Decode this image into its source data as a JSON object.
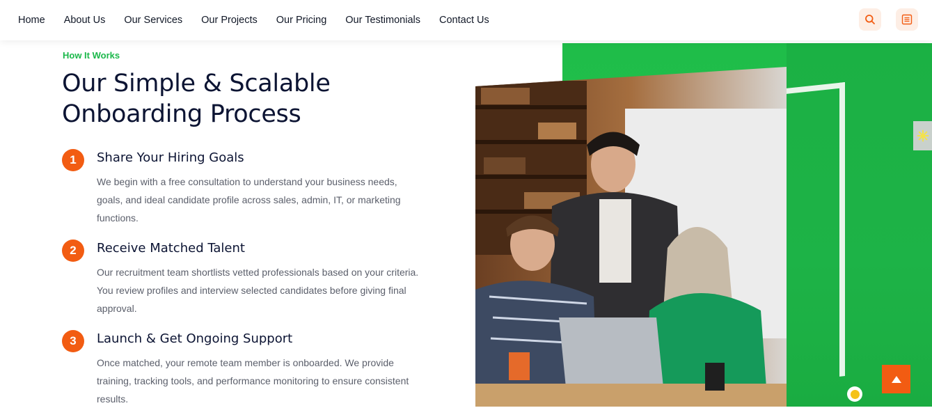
{
  "nav": {
    "items": [
      "Home",
      "About Us",
      "Our Services",
      "Our Projects",
      "Our Pricing",
      "Our Testimonials",
      "Contact Us"
    ]
  },
  "header_icons": {
    "search": "search-icon",
    "menu": "menu-list-icon"
  },
  "section": {
    "eyebrow": "How It Works",
    "title": "Our Simple & Scalable Onboarding Process",
    "steps": [
      {
        "number": "1",
        "title": "Share Your Hiring Goals",
        "desc": "We begin with a free consultation to understand your business needs, goals, and ideal candidate profile across sales, admin, IT, or marketing functions."
      },
      {
        "number": "2",
        "title": "Receive Matched Talent",
        "desc": "Our recruitment team shortlists vetted professionals based on your criteria. You review profiles and interview selected candidates before giving final approval."
      },
      {
        "number": "3",
        "title": "Launch & Get Ongoing Support",
        "desc": "Once matched, your remote team member is onboarded. We provide training, tracking tools, and performance monitoring to ensure consistent results."
      }
    ]
  },
  "colors": {
    "accent_orange": "#f25c12",
    "accent_green": "#1bb84a",
    "heading": "#0c1433",
    "body_text": "#5b5f6b"
  },
  "icons": {
    "side_tab": "settings-sun-icon",
    "back_to_top": "arrow-up-icon",
    "badge": "status-dot-icon"
  }
}
